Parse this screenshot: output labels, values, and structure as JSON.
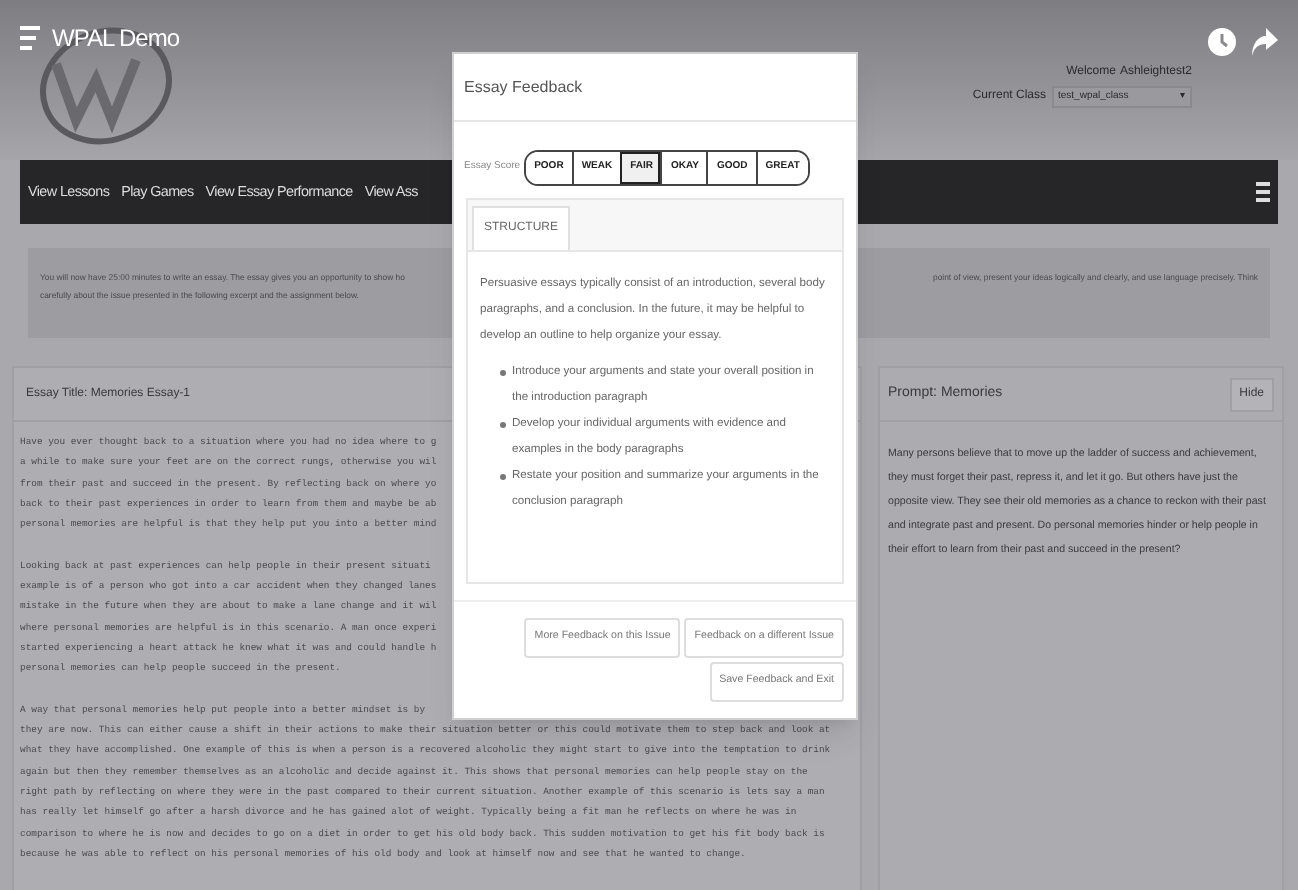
{
  "header": {
    "title": "WPAL Demo",
    "welcome_label": "Welcome",
    "username": "Ashleightest2",
    "class_label": "Current Class",
    "class_value": "test_wpal_class",
    "class_caret": "▾"
  },
  "nav": {
    "items": [
      "View Lessons",
      "Play Games",
      "View Essay Performance",
      "View Ass"
    ]
  },
  "banner": {
    "left": [
      "You will now have 25:00 minutes to write an essay. The essay gives you an opportunity to show ho",
      "carefully about the issue presented in the following excerpt and the assignment below."
    ],
    "right": [
      "point of view, present your ideas logically and clearly, and use language precisely. Think"
    ]
  },
  "essay": {
    "title": "Essay Title: Memories Essay-1",
    "paragraphs": [
      [
        "Have you ever thought back to a situation where you had no idea where to g",
        "a while to make sure your feet are on the correct rungs, otherwise you wil",
        "from their past and succeed in the present. By reflecting back on where yo",
        "back to their past experiences in order to learn from them and maybe be ab",
        "personal memories are helpful is that they help put you into a better mind"
      ],
      [
        "Looking back at past experiences can help people in their present situati",
        "example is of a person who got into a car accident when they changed lanes",
        "mistake in the future when they are about to make a lane change and it wil",
        "where personal memories are helpful is in this scenario. A man once experi",
        "started experiencing a heart attack he knew what it was and could handle h",
        "personal memories can help people succeed in the present."
      ],
      [
        "A way that personal memories help put people into a better mindset is by",
        "they are now. This can either cause a shift in their actions to make their situation better or this could motivate them to step back and look at",
        "what they have accomplished. One example of this is when a person is a recovered alcoholic they might start to give into the temptation to drink",
        "again but then they remember themselves as an alcoholic and decide against it. This shows that personal memories can help people stay on the",
        "right path by reflecting on where they were in the past compared to their current situation. Another example of this scenario is lets say a man",
        "has really let himself go after a harsh divorce and he has gained alot of weight. Typically being a fit man he reflects on where he was in",
        "comparison to where he is now and decides to go on a diet in order to get his old body back. This sudden motivation to get his fit body back is",
        "because he was able to reflect on his personal memories of his old body and look at himself now and see that he wanted to change."
      ]
    ]
  },
  "prompt": {
    "title": "Prompt: Memories",
    "hide_button": "Hide",
    "text": "Many persons believe that to move up the ladder of success and achievement, they must forget their past, repress it, and let it go. But others have just the opposite view. They see their old memories as a chance to reckon with their past and integrate past and present. Do personal memories hinder or help people in their effort to learn from their past and succeed in the present?"
  },
  "modal": {
    "title": "Essay Feedback",
    "score_label": "Essay Score",
    "scores": [
      {
        "label": "POOR",
        "selected": false
      },
      {
        "label": "WEAK",
        "selected": false
      },
      {
        "label": "FAIR",
        "selected": true
      },
      {
        "label": "OKAY",
        "selected": false
      },
      {
        "label": "GOOD",
        "selected": false
      },
      {
        "label": "GREAT",
        "selected": false
      }
    ],
    "tabs": [
      {
        "label": "STRUCTURE",
        "selected": true
      }
    ],
    "intro": "Persuasive essays typically consist of an introduction, several body paragraphs, and a conclusion. In the future, it may be helpful to develop an outline to help organize your essay.",
    "bullets": [
      "Introduce your arguments and state your overall position in the introduction paragraph",
      "Develop your individual arguments with evidence and examples in the body paragraphs",
      "Restate your position and summarize your arguments in the conclusion paragraph"
    ],
    "buttons": [
      "More Feedback on this Issue",
      "Feedback on a different Issue",
      "Save Feedback and Exit"
    ]
  }
}
